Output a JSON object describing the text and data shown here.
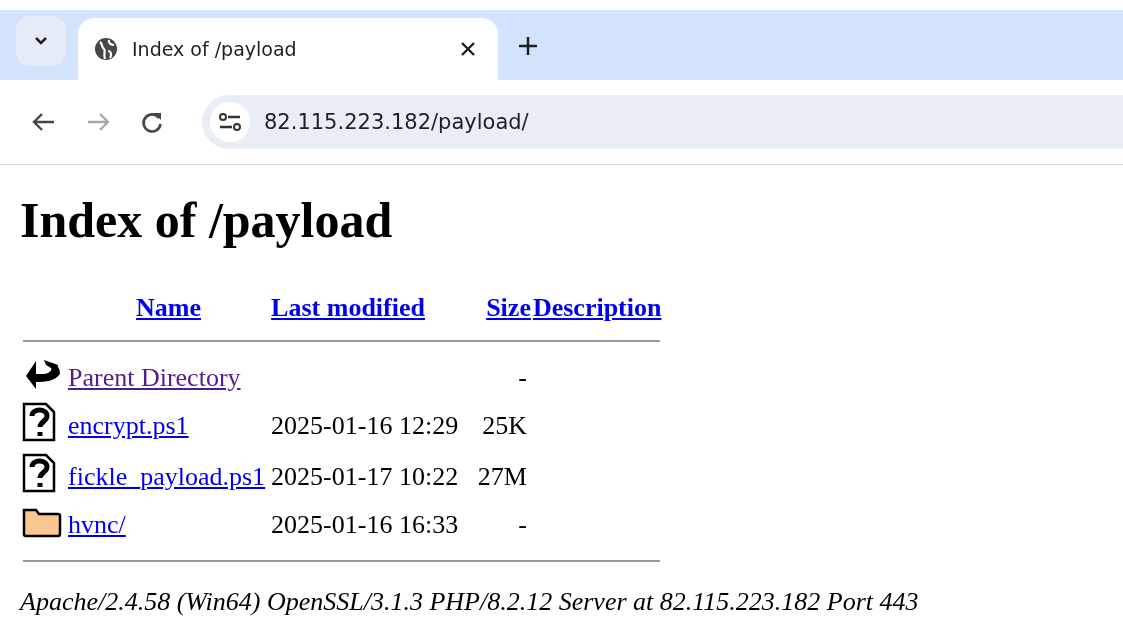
{
  "browser": {
    "tab": {
      "title": "Index of /payload",
      "selected": true
    },
    "address": "82.115.223.182/payload/",
    "forward_disabled": true
  },
  "page": {
    "heading": "Index of /payload",
    "columns": [
      "Name",
      "Last modified",
      "Size",
      "Description"
    ],
    "rows": [
      {
        "kind": "back",
        "name": "Parent Directory",
        "visited": true,
        "modified": "",
        "size": "-"
      },
      {
        "kind": "unknown",
        "name": "encrypt.ps1",
        "visited": false,
        "modified": "2025-01-16 12:29",
        "size": "25K"
      },
      {
        "kind": "unknown",
        "name": "fickle_payload.ps1",
        "visited": false,
        "modified": "2025-01-17 10:22",
        "size": "27M"
      },
      {
        "kind": "folder",
        "name": "hvnc/",
        "visited": false,
        "modified": "2025-01-16 16:33",
        "size": "-"
      }
    ],
    "footer": "Apache/2.4.58 (Win64) OpenSSL/3.1.3 PHP/8.2.12 Server at 82.115.223.182 Port 443"
  }
}
